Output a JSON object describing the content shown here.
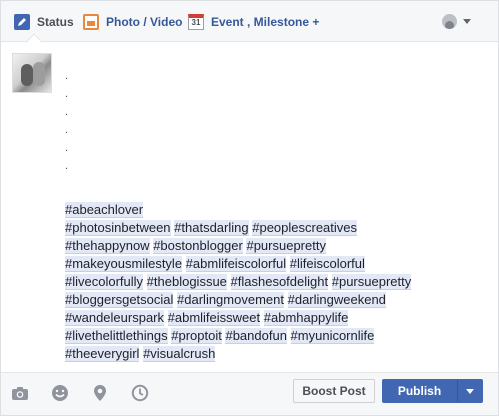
{
  "tabs": [
    {
      "label": "Status",
      "icon": "pencil-icon"
    },
    {
      "label": "Photo / Video",
      "icon": "photo-icon"
    },
    {
      "label": "Event , Milestone +",
      "icon": "calendar-icon",
      "calendar_day": "31"
    }
  ],
  "post": {
    "dots": [
      ".",
      ".",
      ".",
      ".",
      ".",
      "."
    ],
    "hashtag_lines": [
      [
        "#abeachlover"
      ],
      [
        "#photosinbetween",
        "#thatsdarling",
        "#peoplescreatives"
      ],
      [
        "#thehappynow",
        "#bostonblogger",
        "#pursuepretty"
      ],
      [
        "#makeyousmilestyle",
        "#abmlifeiscolorful",
        "#lifeiscolorful"
      ],
      [
        "#livecolorfully",
        "#theblogissue",
        "#flashesofdelight",
        "#pursuepretty"
      ],
      [
        "#bloggersgetsocial",
        "#darlingmovement",
        "#darlingweekend"
      ],
      [
        "#wandeleurspark",
        "#abmlifeissweet",
        "#abmhappylife"
      ],
      [
        "#livethelittlethings",
        "#proptoit",
        "#bandofun",
        "#myunicornlife"
      ],
      [
        "#theeverygirl",
        "#visualcrush"
      ]
    ]
  },
  "footer": {
    "icons": [
      "camera-icon",
      "smiley-icon",
      "location-pin-icon",
      "clock-icon"
    ],
    "boost_label": "Boost Post",
    "publish_label": "Publish"
  },
  "colors": {
    "accent": "#4267b2",
    "tag_highlight": "#e2e8f5",
    "photo_icon": "#e9883d"
  }
}
